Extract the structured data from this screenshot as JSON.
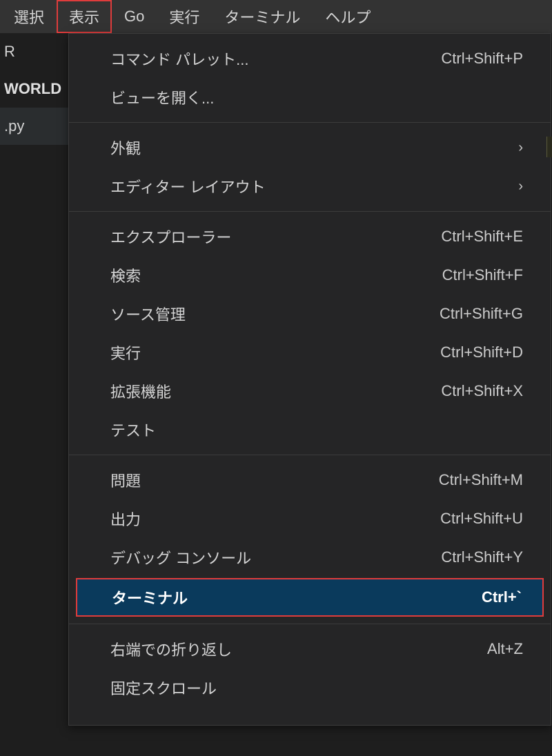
{
  "menubar": {
    "items": [
      "選択",
      "表示",
      "Go",
      "実行",
      "ターミナル",
      "ヘルプ"
    ],
    "highlighted_index": 1
  },
  "sidebar": {
    "r": "R",
    "w": "WORLD",
    "py": ".py"
  },
  "dropdown": {
    "groups": [
      [
        {
          "label": "コマンド パレット...",
          "shortcut": "Ctrl+Shift+P",
          "submenu": false
        },
        {
          "label": "ビューを開く...",
          "shortcut": "",
          "submenu": false
        }
      ],
      [
        {
          "label": "外観",
          "shortcut": "",
          "submenu": true
        },
        {
          "label": "エディター レイアウト",
          "shortcut": "",
          "submenu": true
        }
      ],
      [
        {
          "label": "エクスプローラー",
          "shortcut": "Ctrl+Shift+E",
          "submenu": false
        },
        {
          "label": "検索",
          "shortcut": "Ctrl+Shift+F",
          "submenu": false
        },
        {
          "label": "ソース管理",
          "shortcut": "Ctrl+Shift+G",
          "submenu": false
        },
        {
          "label": "実行",
          "shortcut": "Ctrl+Shift+D",
          "submenu": false
        },
        {
          "label": "拡張機能",
          "shortcut": "Ctrl+Shift+X",
          "submenu": false
        },
        {
          "label": "テスト",
          "shortcut": "",
          "submenu": false
        }
      ],
      [
        {
          "label": "問題",
          "shortcut": "Ctrl+Shift+M",
          "submenu": false
        },
        {
          "label": "出力",
          "shortcut": "Ctrl+Shift+U",
          "submenu": false
        },
        {
          "label": "デバッグ コンソール",
          "shortcut": "Ctrl+Shift+Y",
          "submenu": false
        },
        {
          "label": "ターミナル",
          "shortcut": "Ctrl+`",
          "submenu": false,
          "selected": true
        }
      ],
      [
        {
          "label": "右端での折り返し",
          "shortcut": "Alt+Z",
          "submenu": false
        },
        {
          "label": "固定スクロール",
          "shortcut": "",
          "submenu": false
        }
      ]
    ]
  }
}
